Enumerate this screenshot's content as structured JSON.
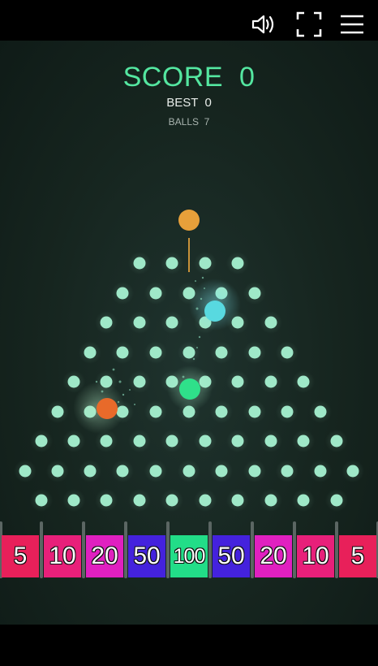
{
  "toolbar": {
    "sound_icon": "speaker-icon",
    "fullscreen_icon": "fullscreen-icon",
    "menu_icon": "hamburger-menu-icon"
  },
  "hud": {
    "score_label": "SCORE",
    "score_value": "0",
    "best_label": "BEST",
    "best_value": "0",
    "balls_label": "BALLS",
    "balls_value": "7"
  },
  "colors": {
    "peg": "#9fe8c8",
    "launcher": "#e7a03a",
    "score_text": "#54e6a0",
    "background": "#18271f"
  },
  "buckets": [
    {
      "label": "5",
      "color": "#e8205a"
    },
    {
      "label": "10",
      "color": "#e8207a"
    },
    {
      "label": "20",
      "color": "#e020c0"
    },
    {
      "label": "50",
      "color": "#4422dd"
    },
    {
      "label": "100",
      "color": "#22dd88"
    },
    {
      "label": "50",
      "color": "#4422dd"
    },
    {
      "label": "20",
      "color": "#e020c0"
    },
    {
      "label": "10",
      "color": "#e8207a"
    },
    {
      "label": "5",
      "color": "#e8205a"
    }
  ],
  "falling_balls": [
    {
      "name": "cyan-ball",
      "color": "#58d9e0"
    },
    {
      "name": "green-ball",
      "color": "#2fe08a"
    },
    {
      "name": "orange-ball",
      "color": "#e86a2a"
    }
  ]
}
